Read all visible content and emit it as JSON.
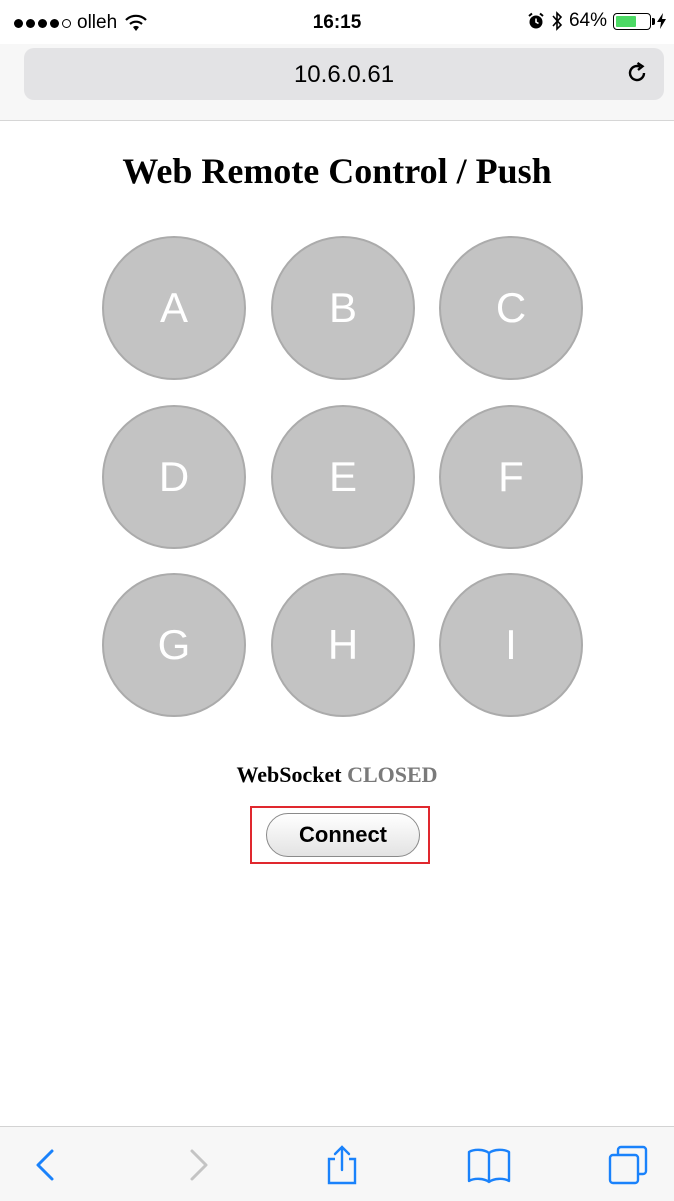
{
  "status_bar": {
    "carrier": "olleh",
    "time": "16:15",
    "battery_percent": "64%",
    "battery_level": 0.64,
    "signal_bars": 4,
    "icons": [
      "signal-icon",
      "wifi-icon",
      "alarm-icon",
      "bluetooth-icon",
      "battery-icon",
      "charging-icon"
    ]
  },
  "address_bar": {
    "url": "10.6.0.61",
    "reload_icon": "reload-icon"
  },
  "page": {
    "title": "Web Remote Control / Push",
    "buttons": [
      "A",
      "B",
      "C",
      "D",
      "E",
      "F",
      "G",
      "H",
      "I"
    ],
    "websocket_label": "WebSocket",
    "websocket_state": "CLOSED",
    "connect_label": "Connect"
  },
  "toolbar": {
    "icons": [
      "back-icon",
      "forward-icon",
      "share-icon",
      "bookmarks-icon",
      "tabs-icon"
    ]
  },
  "colors": {
    "circle_button": "#c3c3c3",
    "highlight": "#e0282e",
    "link_blue": "#1a82fb",
    "battery_green": "#4cd964"
  }
}
